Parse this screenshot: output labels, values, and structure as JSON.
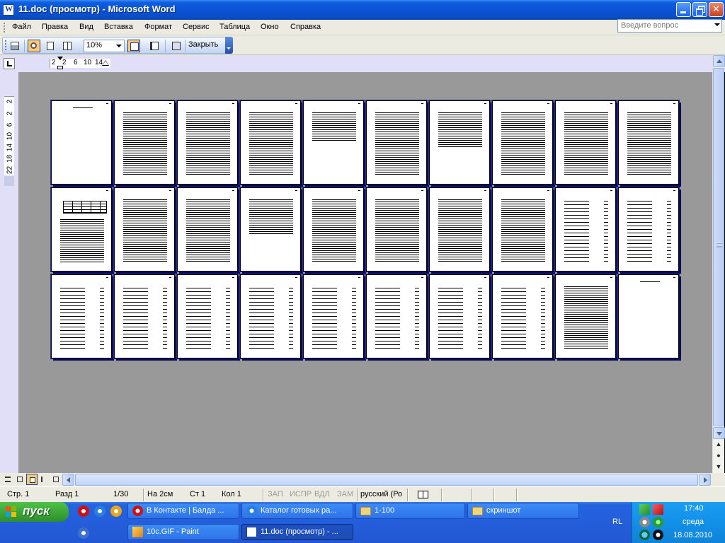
{
  "window": {
    "title": "11.doc (просмотр) - Microsoft Word"
  },
  "menu": {
    "items": [
      "Файл",
      "Правка",
      "Вид",
      "Вставка",
      "Формат",
      "Сервис",
      "Таблица",
      "Окно",
      "Справка"
    ],
    "ask_placeholder": "Введите вопрос"
  },
  "toolbar": {
    "zoom": "10%",
    "close_label": "Закрыть",
    "icons": [
      "print-icon",
      "magnifier-icon",
      "one-page-icon",
      "multiple-pages-icon",
      "view-ruler-icon",
      "shrink-to-fit-icon",
      "full-screen-icon"
    ]
  },
  "ruler": {
    "ticks": [
      "2",
      "2",
      "6",
      "10",
      "14"
    ],
    "vticks": [
      "2",
      "2",
      "6",
      "10",
      "14",
      "18",
      "22"
    ]
  },
  "document": {
    "pages_total": 30
  },
  "status": {
    "page": "Стр. 1",
    "section": "Разд 1",
    "pages": "1/30",
    "at": "На 2см",
    "line": "Ст 1",
    "col": "Кол 1",
    "rec": "ЗАП",
    "trk": "ИСПР",
    "ext": "ВДЛ",
    "ovr": "ЗАМ",
    "language": "русский (Ро"
  },
  "taskbar": {
    "start_label": "пуск",
    "tasks_row1": [
      {
        "label": "В Контакте | Балда ...",
        "icon": "opera-icon"
      },
      {
        "label": "Каталог готовых ра...",
        "icon": "ie-icon"
      },
      {
        "label": "1-100",
        "icon": "folder-icon"
      },
      {
        "label": "скриншот",
        "icon": "folder-icon"
      }
    ],
    "tasks_row2": [
      {
        "label": "10c.GIF - Paint",
        "icon": "paint-icon"
      },
      {
        "label": "11.doc (просмотр) - ...",
        "icon": "word-icon"
      }
    ],
    "language": "RL",
    "time": "17:40",
    "day": "среда",
    "date": "18.08.2010"
  }
}
